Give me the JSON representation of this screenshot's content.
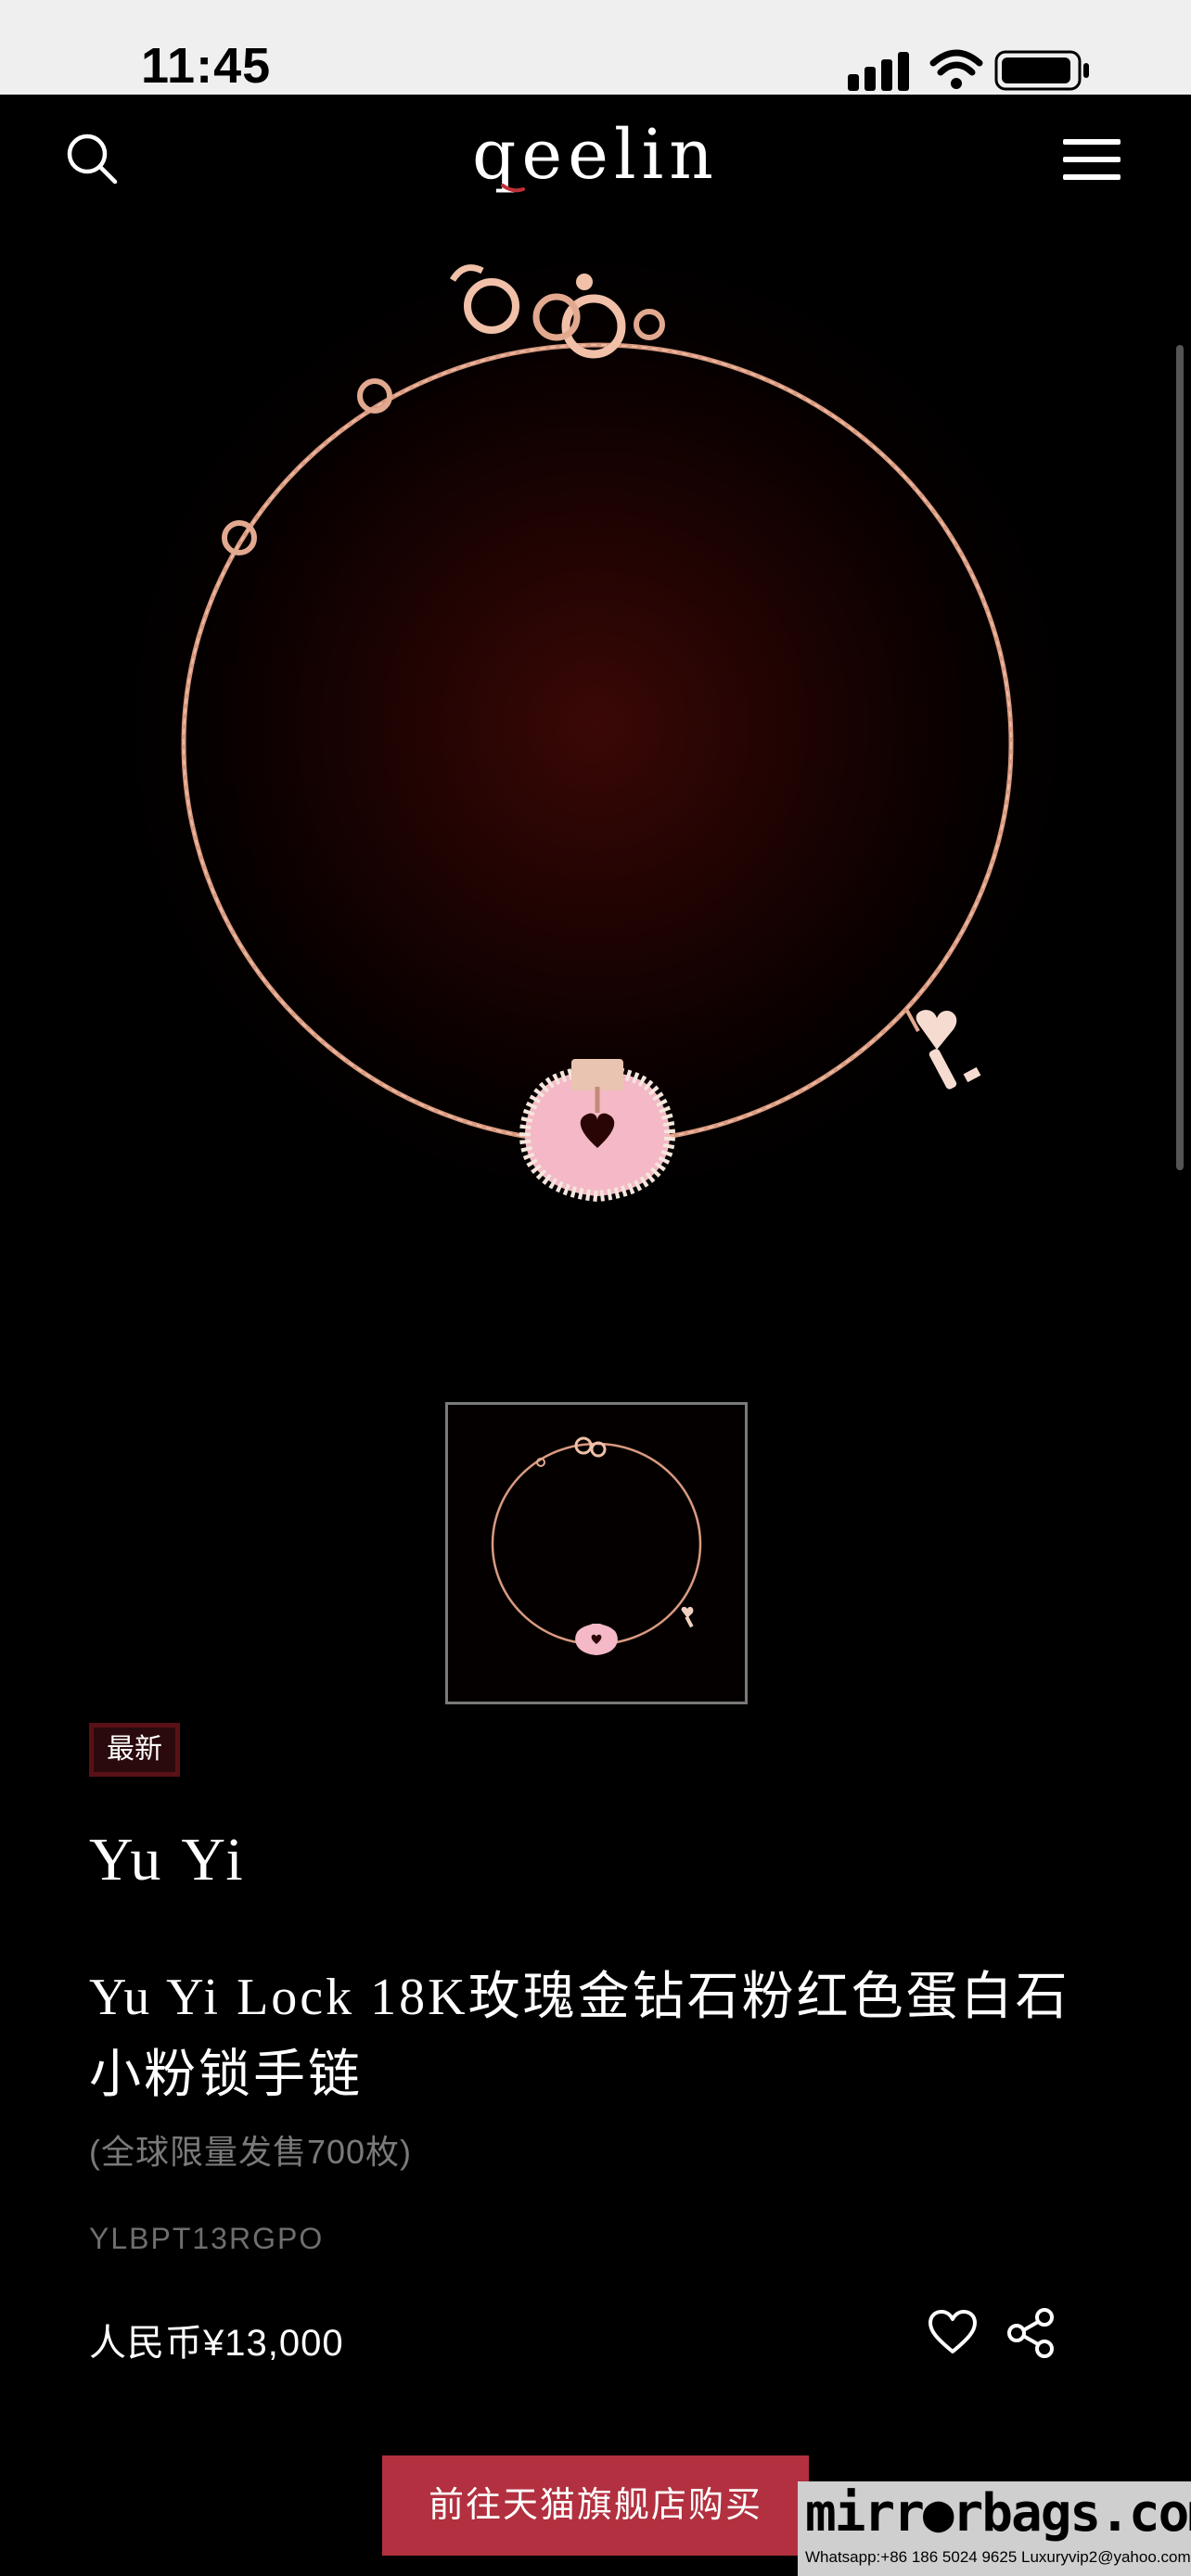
{
  "status_bar": {
    "time": "11:45"
  },
  "header": {
    "logo": "qeelin",
    "icons": [
      "search-icon",
      "menu-icon"
    ]
  },
  "colors": {
    "background": "#000000",
    "accent": "#b2303f",
    "badge_border": "#5a1116",
    "rose_gold": "#e2a98f",
    "enamel_pink": "#f4b8c6"
  },
  "product": {
    "badge": "最新",
    "collection": "Yu Yi",
    "title": "Yu Yi Lock 18K玫瑰金钻石粉红色蛋白石小粉锁手链",
    "note": "(全球限量发售700枚)",
    "sku": "YLBPT13RGPO",
    "price": "人民币¥13,000"
  },
  "actions": {
    "buy_label": "前往天猫旗舰店购买",
    "icons": [
      "heart-icon",
      "share-icon"
    ]
  },
  "watermark": {
    "main": "mirr●rbags.com",
    "sub": "Whatsapp:+86 186 5024 9625   Luxuryvip2@yahoo.com"
  }
}
